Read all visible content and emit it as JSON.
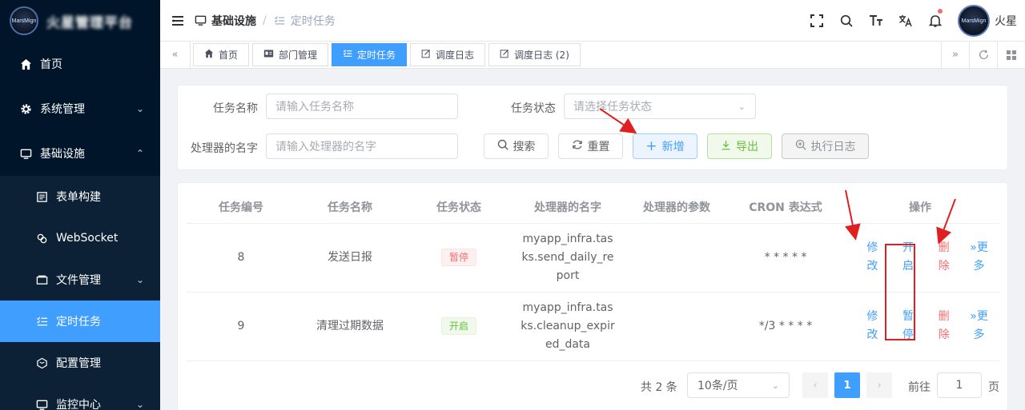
{
  "brand": {
    "logo_text": "MarsMign"
  },
  "sidebar": {
    "items": [
      {
        "label": "首页",
        "icon": "home-icon"
      },
      {
        "label": "系统管理",
        "icon": "gear-icon"
      },
      {
        "label": "基础设施",
        "icon": "monitor-icon"
      }
    ],
    "subitems": [
      {
        "label": "表单构建",
        "icon": "form-icon"
      },
      {
        "label": "WebSocket",
        "icon": "link-icon"
      },
      {
        "label": "文件管理",
        "icon": "folder-icon"
      },
      {
        "label": "定时任务",
        "icon": "list-icon",
        "active": true
      },
      {
        "label": "配置管理",
        "icon": "cube-icon"
      },
      {
        "label": "监控中心",
        "icon": "monitor-icon"
      }
    ]
  },
  "header": {
    "breadcrumb": [
      "基础设施",
      "定时任务"
    ],
    "user_name": "火星",
    "avatar_text": "MarsMign"
  },
  "tabs": [
    {
      "label": "首页",
      "icon": "home-icon"
    },
    {
      "label": "部门管理",
      "icon": "idcard-icon"
    },
    {
      "label": "定时任务",
      "icon": "list-icon",
      "active": true
    },
    {
      "label": "调度日志",
      "icon": "edit-icon"
    },
    {
      "label": "调度日志 (2)",
      "icon": "edit-icon"
    }
  ],
  "search": {
    "task_name_label": "任务名称",
    "task_name_placeholder": "请输入任务名称",
    "task_status_label": "任务状态",
    "task_status_placeholder": "请选择任务状态",
    "handler_label": "处理器的名字",
    "handler_placeholder": "请输入处理器的名字",
    "buttons": {
      "search": "搜索",
      "reset": "重置",
      "add": "新增",
      "export": "导出",
      "log": "执行日志"
    }
  },
  "table": {
    "columns": [
      "任务编号",
      "任务名称",
      "任务状态",
      "处理器的名字",
      "处理器的参数",
      "CRON 表达式",
      "操作"
    ],
    "rows": [
      {
        "id": "8",
        "name": "发送日报",
        "status": "暂停",
        "status_type": "pause",
        "handler": [
          "myapp_infra.tas",
          "ks.send_daily_re",
          "port"
        ],
        "params": "",
        "cron": "* * * * *",
        "ops": {
          "edit": "修改",
          "toggle": "开启",
          "delete": "删除",
          "more": "更多"
        }
      },
      {
        "id": "9",
        "name": "清理过期数据",
        "status": "开启",
        "status_type": "run",
        "handler": [
          "myapp_infra.tas",
          "ks.cleanup_expir",
          "ed_data"
        ],
        "params": "",
        "cron": "*/3 * * * *",
        "ops": {
          "edit": "修改",
          "toggle": "暂停",
          "delete": "删除",
          "more": "更多"
        }
      }
    ]
  },
  "pagination": {
    "total_text": "共 2 条",
    "page_size": "10条/页",
    "current_page": "1",
    "goto_label": "前往",
    "goto_value": "1",
    "page_suffix": "页"
  },
  "colors": {
    "primary": "#409eff",
    "danger": "#f56c6c",
    "success": "#67c23a",
    "sidebar": "#001529",
    "annotation": "#e02020"
  }
}
